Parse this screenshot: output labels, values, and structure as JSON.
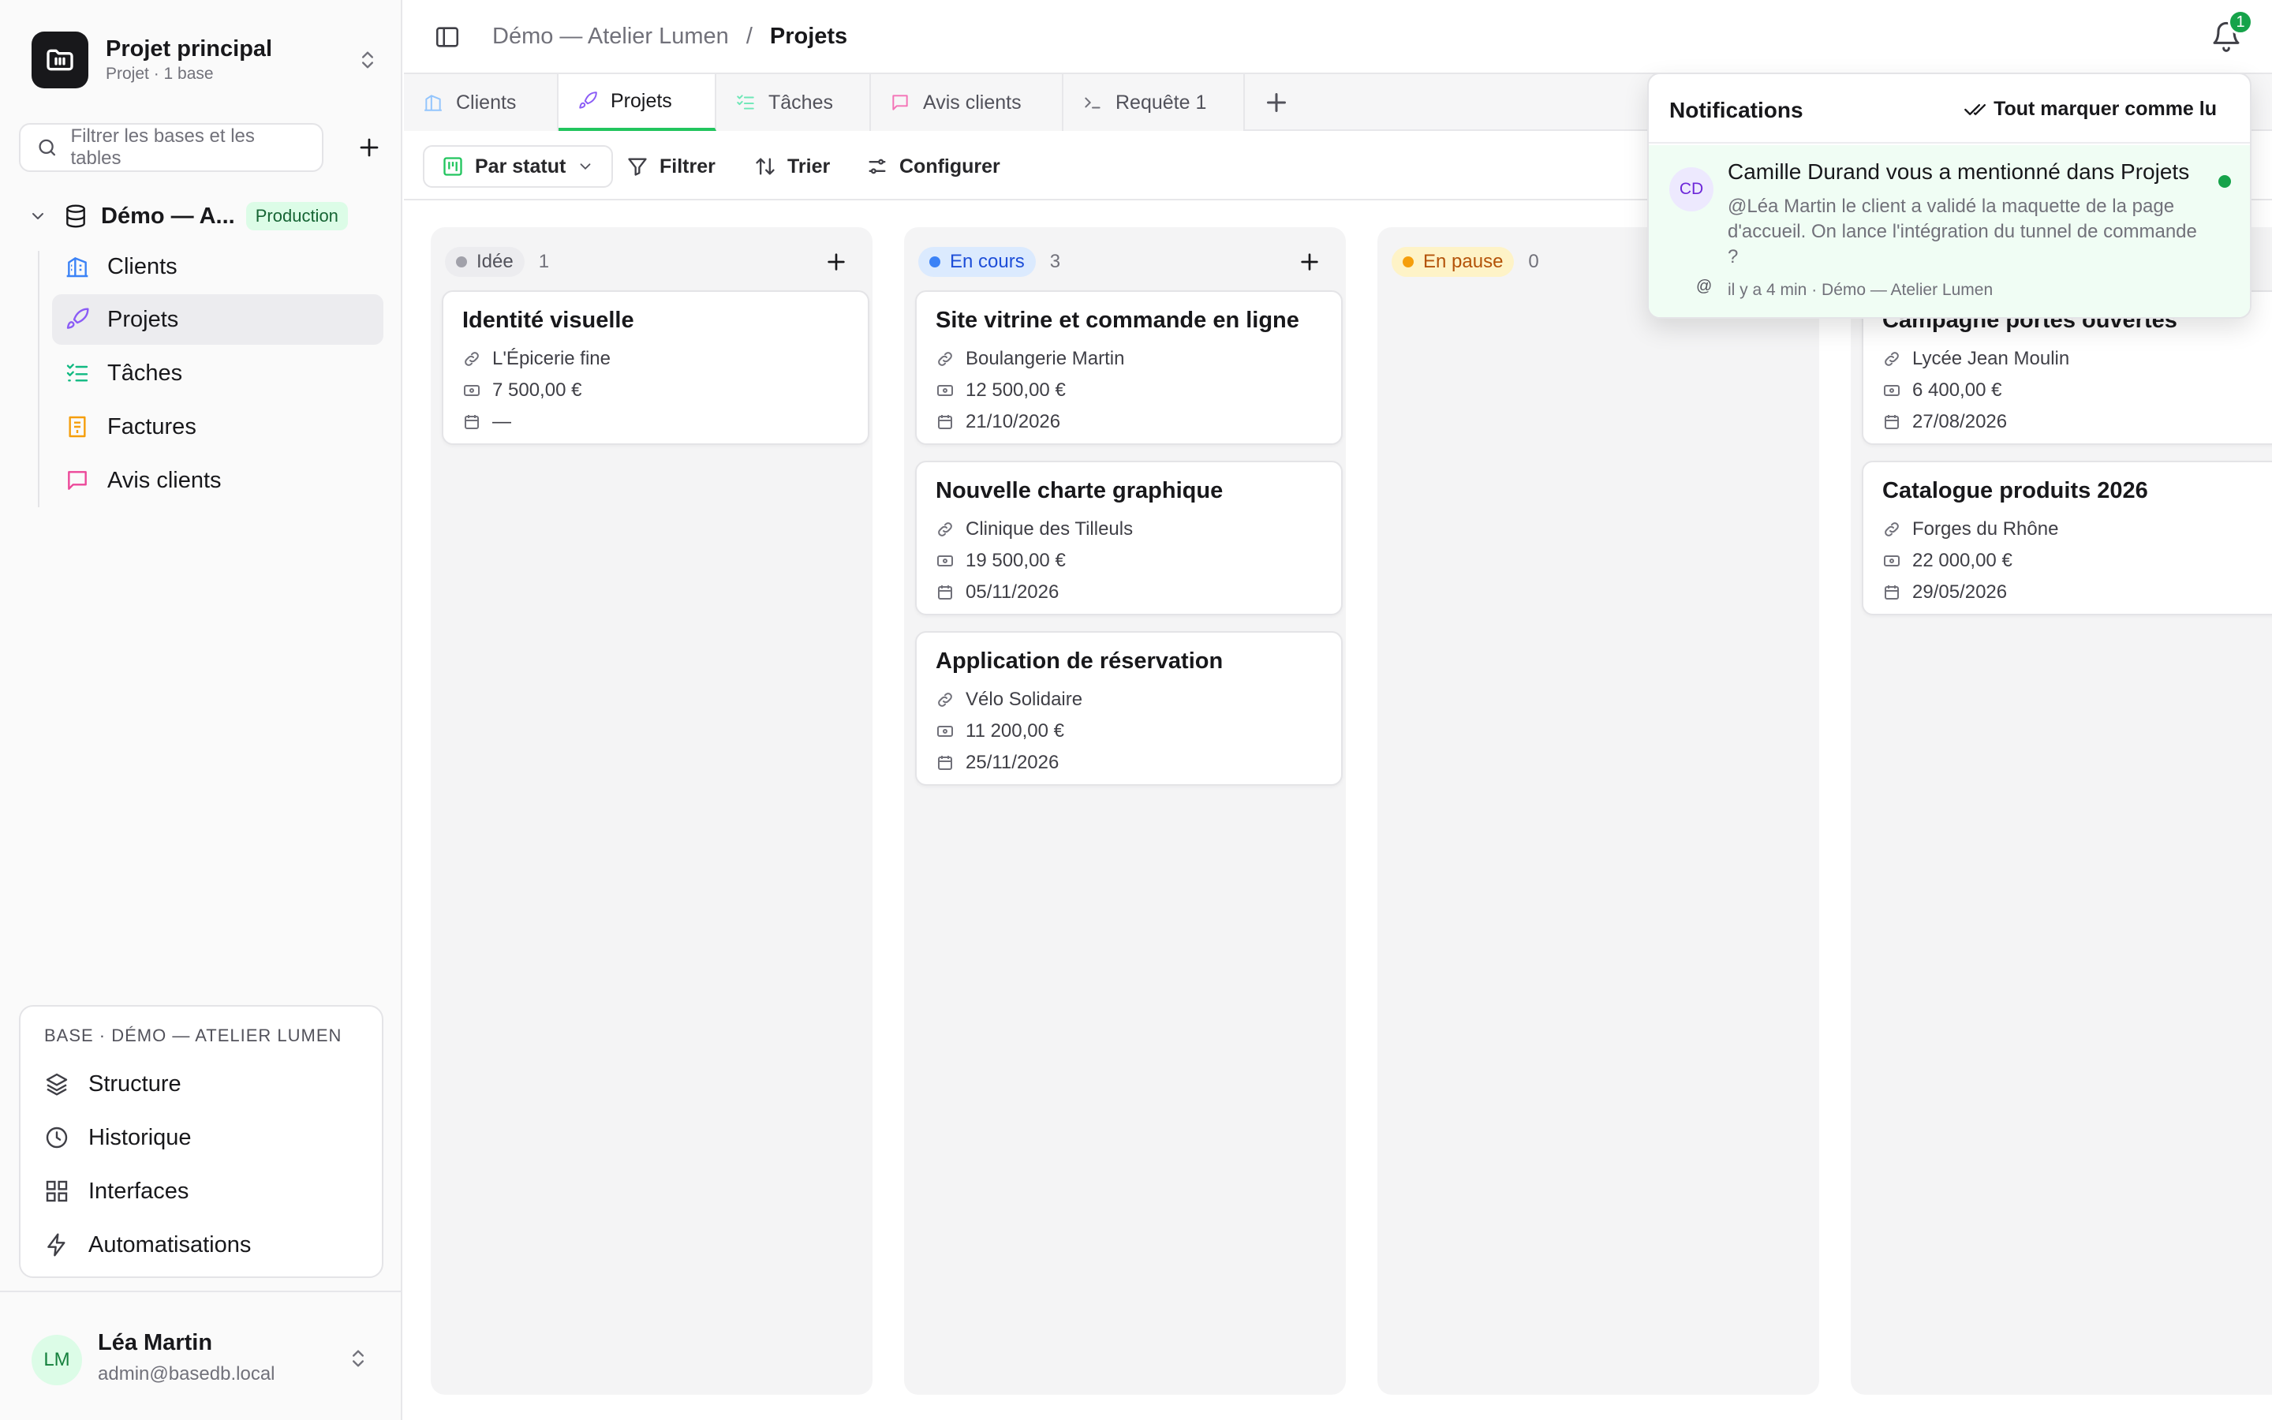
{
  "sidebar": {
    "project": {
      "name": "Projet principal",
      "subtitle": "Projet · 1 base"
    },
    "filter": {
      "placeholder": "Filtrer les bases et les tables"
    },
    "base": {
      "name": "Démo — A...",
      "badge": "Production"
    },
    "items": [
      {
        "label": "Clients",
        "icon": "building-icon",
        "color": "#3b82f6"
      },
      {
        "label": "Projets",
        "icon": "rocket-icon",
        "color": "#8b5cf6",
        "active": true
      },
      {
        "label": "Tâches",
        "icon": "checklist-icon",
        "color": "#10b981"
      },
      {
        "label": "Factures",
        "icon": "invoice-icon",
        "color": "#f59e0b"
      },
      {
        "label": "Avis clients",
        "icon": "message-icon",
        "color": "#ec4899"
      }
    ],
    "base_card": {
      "title": "BASE · DÉMO — ATELIER LUMEN",
      "items": [
        {
          "label": "Structure",
          "icon": "layers-icon"
        },
        {
          "label": "Historique",
          "icon": "clock-icon"
        },
        {
          "label": "Interfaces",
          "icon": "layout-grid-icon"
        },
        {
          "label": "Automatisations",
          "icon": "bolt-icon"
        }
      ]
    },
    "user": {
      "initials": "LM",
      "name": "Léa Martin",
      "email": "admin@basedb.local"
    }
  },
  "header": {
    "breadcrumb": {
      "parent": "Démo — Atelier Lumen",
      "separator": "/",
      "current": "Projets"
    },
    "notification_count": "1"
  },
  "tabs": [
    {
      "label": "Clients",
      "icon": "building-icon"
    },
    {
      "label": "Projets",
      "icon": "rocket-icon",
      "active": true
    },
    {
      "label": "Tâches",
      "icon": "checklist-icon"
    },
    {
      "label": "Avis clients",
      "icon": "message-icon"
    },
    {
      "label": "Requête 1",
      "icon": "terminal-icon"
    }
  ],
  "toolbar": {
    "group": "Par statut",
    "filter": "Filtrer",
    "sort": "Trier",
    "configure": "Configurer"
  },
  "board": {
    "columns": [
      {
        "status": "Idée",
        "count": "1",
        "dot": "#a1a1aa",
        "bg": "#ececef",
        "fg": "#52525b",
        "cards": [
          {
            "title": "Identité visuelle",
            "client": "L'Épicerie fine",
            "amount": "7 500,00 €",
            "date": "—"
          }
        ]
      },
      {
        "status": "En cours",
        "count": "3",
        "dot": "#3b82f6",
        "bg": "#dbeafe",
        "fg": "#1d4ed8",
        "cards": [
          {
            "title": "Site vitrine et commande en ligne",
            "client": "Boulangerie Martin",
            "amount": "12 500,00 €",
            "date": "21/10/2026"
          },
          {
            "title": "Nouvelle charte graphique",
            "client": "Clinique des Tilleuls",
            "amount": "19 500,00 €",
            "date": "05/11/2026"
          },
          {
            "title": "Application de réservation",
            "client": "Vélo Solidaire",
            "amount": "11 200,00 €",
            "date": "25/11/2026"
          }
        ]
      },
      {
        "status": "En pause",
        "count": "0",
        "dot": "#f59e0b",
        "bg": "#fef3c7",
        "fg": "#b45309",
        "cards": []
      },
      {
        "status": "",
        "count": "",
        "dot": "#22c55e",
        "bg": "#dcfce7",
        "fg": "#15803d",
        "cards": [
          {
            "title": "Campagne portes ouvertes",
            "client": "Lycée Jean Moulin",
            "amount": "6 400,00 €",
            "date": "27/08/2026"
          },
          {
            "title": "Catalogue produits 2026",
            "client": "Forges du Rhône",
            "amount": "22 000,00 €",
            "date": "29/05/2026"
          }
        ]
      }
    ]
  },
  "notifications": {
    "title": "Notifications",
    "mark_all": "Tout marquer comme lu",
    "items": [
      {
        "initials": "CD",
        "title": "Camille Durand vous a mentionné dans Projets",
        "body": "@Léa Martin le client a validé la maquette de la page d'accueil. On lance l'intégration du tunnel de commande ?",
        "meta": "il y a 4 min · Démo — Atelier Lumen",
        "mention_symbol": "@"
      }
    ]
  }
}
